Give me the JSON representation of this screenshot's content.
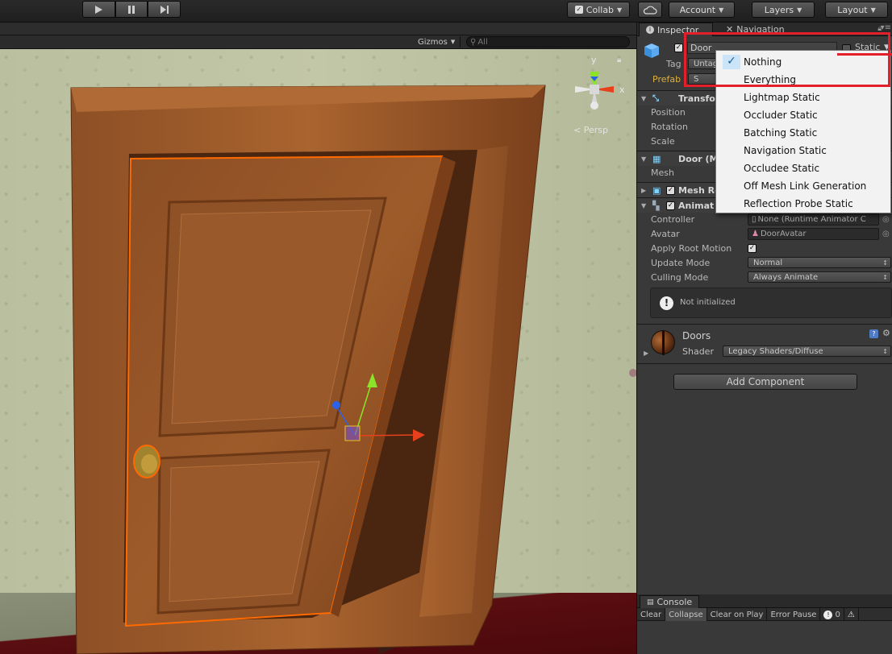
{
  "toolbar": {
    "collab_label": "Collab",
    "account_label": "Account",
    "layers_label": "Layers",
    "layout_label": "Layout"
  },
  "scene": {
    "gizmos_label": "Gizmos",
    "search_placeholder": "All",
    "persp_label": "Persp",
    "axis_y": "y",
    "axis_x": "x"
  },
  "inspector": {
    "tab_inspector": "Inspector",
    "tab_navigation": "Navigation",
    "object_name": "Door",
    "static_label": "Static",
    "tag_label": "Tag",
    "tag_value": "Untag",
    "prefab_label": "Prefab",
    "prefab_btn": "S",
    "transform": {
      "title": "Transfo",
      "position_label": "Position",
      "rotation_label": "Rotation",
      "scale_label": "Scale"
    },
    "mesh_filter": {
      "title": "Door (M",
      "mesh_label": "Mesh"
    },
    "mesh_renderer": {
      "title": "Mesh Re"
    },
    "animator": {
      "title": "Animat",
      "controller_label": "Controller",
      "controller_value": "None (Runtime Animator C",
      "avatar_label": "Avatar",
      "avatar_value": "DoorAvatar",
      "apply_root_motion_label": "Apply Root Motion",
      "update_mode_label": "Update Mode",
      "update_mode_value": "Normal",
      "culling_mode_label": "Culling Mode",
      "culling_mode_value": "Always Animate",
      "notice": "Not initialized"
    },
    "material": {
      "name": "Doors",
      "shader_label": "Shader",
      "shader_value": "Legacy Shaders/Diffuse"
    },
    "add_component": "Add Component"
  },
  "static_menu": {
    "items": [
      "Nothing",
      "Everything",
      "Lightmap Static",
      "Occluder Static",
      "Batching Static",
      "Navigation Static",
      "Occludee Static",
      "Off Mesh Link Generation",
      "Reflection Probe Static"
    ],
    "checked_item": "Nothing"
  },
  "console": {
    "tab_label": "Console",
    "clear": "Clear",
    "collapse": "Collapse",
    "clear_on_play": "Clear on Play",
    "error_pause": "Error Pause",
    "error_count": "0"
  },
  "colors": {
    "highlight_red": "#e21f2a",
    "menu_bg": "#f2f2f2",
    "selection_orange": "#ff6a00",
    "prefab_text": "#e0b13a"
  }
}
